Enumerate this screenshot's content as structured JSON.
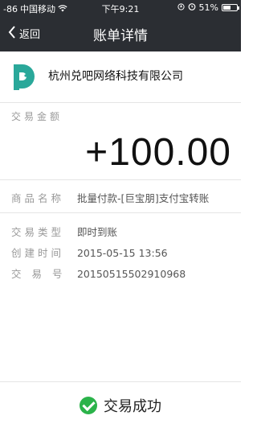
{
  "status_bar": {
    "signal": "-86",
    "carrier": "中国移动",
    "time": "下午9:21",
    "battery": "51%"
  },
  "nav": {
    "back_label": "返回",
    "title": "账单详情"
  },
  "merchant": {
    "name": "杭州兑吧网络科技有限公司"
  },
  "amount": {
    "label": "交易金额",
    "value": "+100.00"
  },
  "details": {
    "product_label": "商品名称",
    "product_value": "批量付款-[巨宝朋]支付宝转账",
    "type_label": "交易类型",
    "type_value": "即时到账",
    "created_label": "创建时间",
    "created_value": "2015-05-15 13:56",
    "number_label": "交易号",
    "number_value": "20150515502910968"
  },
  "footer": {
    "status": "交易成功"
  },
  "colors": {
    "header_bg": "#2b2e33",
    "success_green": "#2bb34a",
    "logo_teal": "#2aa89a"
  }
}
